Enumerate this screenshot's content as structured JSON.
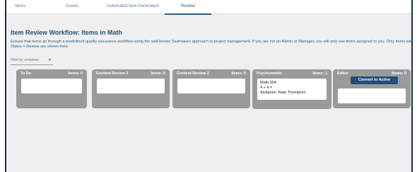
{
  "tabs": [
    {
      "label": "Items"
    },
    {
      "label": "Assets"
    },
    {
      "label": "Automated Item Generation"
    },
    {
      "label": "Review",
      "active": true
    }
  ],
  "page_title": "Item Review Workflow: Items in Math",
  "description": "Ensure that items go through a predefined quality assurance workflow using the well-known Swimlanes approach to project management. If you are not an Admin or Manager, you will only see items assigned to you. Only items with Status = Review are shown here.",
  "filter": {
    "placeholder": "Filter by assignee:"
  },
  "lanes": [
    {
      "title": "To Do",
      "count_label": "Items: 0"
    },
    {
      "title": "Content Review 1",
      "count_label": "Items: 0"
    },
    {
      "title": "Content Review 2",
      "count_label": "Items: 0"
    },
    {
      "title": "Psychometric",
      "count_label": "Items: 1",
      "card": {
        "name": "Math.004",
        "content": "4 + 4 =",
        "assignee": "Assignee: Nate Thompson"
      }
    },
    {
      "title": "Editor",
      "count_label": "Items: 0",
      "button_label": "Convert to Active"
    }
  ],
  "colors": {
    "accent": "#1e4f79",
    "lane_bg": "#9a9a9a",
    "button": "#1f4e78",
    "tab_text": "#5b7fa6"
  }
}
